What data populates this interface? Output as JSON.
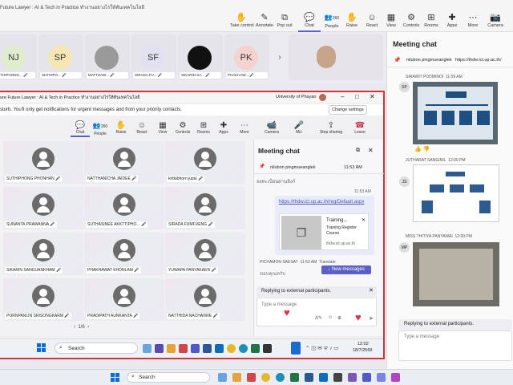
{
  "meeting": {
    "title": "Future Lawyer : AI & Tech in Practice ทำงานอย่างไรให้ทันเทคโนโลยี"
  },
  "toolbar": {
    "take_control": "Take control",
    "annotate": "Annotate",
    "pop_out": "Pop out",
    "chat": "Chat",
    "people": "People",
    "people_count": "260",
    "raise": "Raise",
    "react": "React",
    "view": "View",
    "controls": "Controls",
    "rooms": "Rooms",
    "apps": "Apps",
    "more": "More",
    "camera": "Camera",
    "mic": "Mic",
    "stop_sharing": "Stop sharing",
    "leave": "Leave"
  },
  "participants_strip": [
    {
      "initials": "NJ",
      "name": "SUTHIPHONG...",
      "color": "#dfeccd"
    },
    {
      "initials": "SP",
      "name": "SUTHIPO...",
      "color": "#f6e6b4"
    },
    {
      "initials": "",
      "name": "MATTHAW...",
      "color": "#9a9a9a"
    },
    {
      "initials": "SF",
      "name": "SIRADA FU...",
      "color": "#e1e1f2"
    },
    {
      "initials": "",
      "name": "SIKARIN SA...",
      "color": "#111111"
    },
    {
      "initials": "PK",
      "name": "PHAKHAW...",
      "color": "#f6d2cf"
    }
  ],
  "inner_window": {
    "title": "ure Future Lawyer : AI & Tech in Practice ทำงานอย่างไรให้ทันเทคโนโลยี",
    "org": "University of Phayao",
    "notification": "sturb. You'll only get notifications for urgent messages and from your priority contacts.",
    "change_settings": "Change settings",
    "grid": [
      "SUTHIPHONG PHONHAN",
      "NATTHANICHA JAIDEE",
      "krittabhorn jupai",
      "SUNANTA PRAWANNA",
      "SUTHASINEE AKKTTIPHO...",
      "SIRADA FUMFUENG",
      "SIKARIN SANGUANKHAM",
      "PHAKHAWAT KHONLAM",
      "YUWAPA PANYAKAEN",
      "PORNPANLIN SRISONGKARM",
      "PRADIPATH AUNKANTA",
      "NATTHIDA NACHAIWIE"
    ],
    "pagination": "1/6"
  },
  "inner_chat": {
    "title": "Meeting chat",
    "pinned_by": "nilubon pingmueanglek",
    "pinned_time": "11:53 AM",
    "msg_time1": "11:53 AM",
    "thai_msg": "ลงทะเบียนผ่านลิงก์",
    "link": "https://thdw.ict.up.ac.th/reg/Default.aspx",
    "card_title": "Training...",
    "card_sub": "Training Register Course",
    "card_domain": "thdw.ict.up.ac.th",
    "sender": "PICHAMON SAESAT",
    "sender_time": "11:53 AM",
    "translate": "Translate",
    "thai_msg2": "ขอบคุณครับ",
    "new_messages": "New messages",
    "reply_external": "Replying to external participants.",
    "type_placeholder": "Type a message"
  },
  "outer_chat": {
    "title": "Meeting chat",
    "pinned_by": "nilubon pingmueanglek",
    "pinned_link": "https://thdw.ict.up.ac.th/",
    "messages": [
      {
        "initials": "SP",
        "sender": "SIRAWIT PODMINOI",
        "time": "11:59 AM"
      },
      {
        "initials": "JS",
        "sender": "JUTHARAT SANGINIL",
        "time": "12:00 PM"
      },
      {
        "initials": "MP",
        "sender": "MISS THITIYA PANYAWAI",
        "time": "12:00 PM"
      }
    ],
    "reply_external": "Replying to external participants.",
    "type_placeholder": "Type a message"
  },
  "inner_taskbar": {
    "search": "Search",
    "time": "12:02",
    "date": "18/7/2569"
  },
  "outer_taskbar": {
    "search": "Search"
  }
}
